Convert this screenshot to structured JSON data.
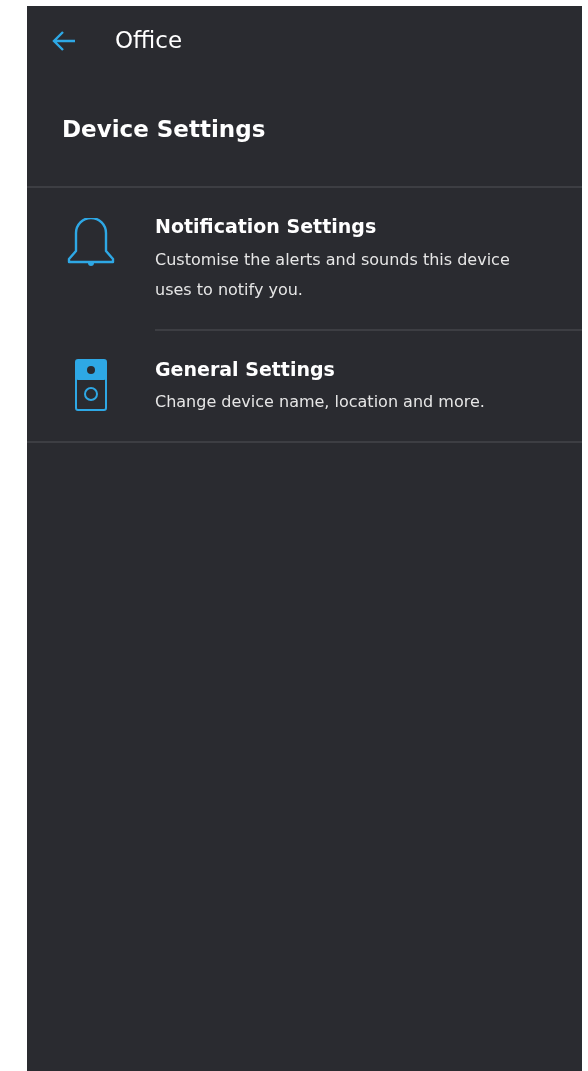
{
  "header": {
    "title": "Office"
  },
  "section_title": "Device Settings",
  "items": [
    {
      "kind": "bell",
      "title": "Notification Settings",
      "description": "Customise the alerts and sounds this device uses to notify you."
    },
    {
      "kind": "doorbell",
      "title": "General Settings",
      "description": "Change device name, location and more."
    }
  ]
}
